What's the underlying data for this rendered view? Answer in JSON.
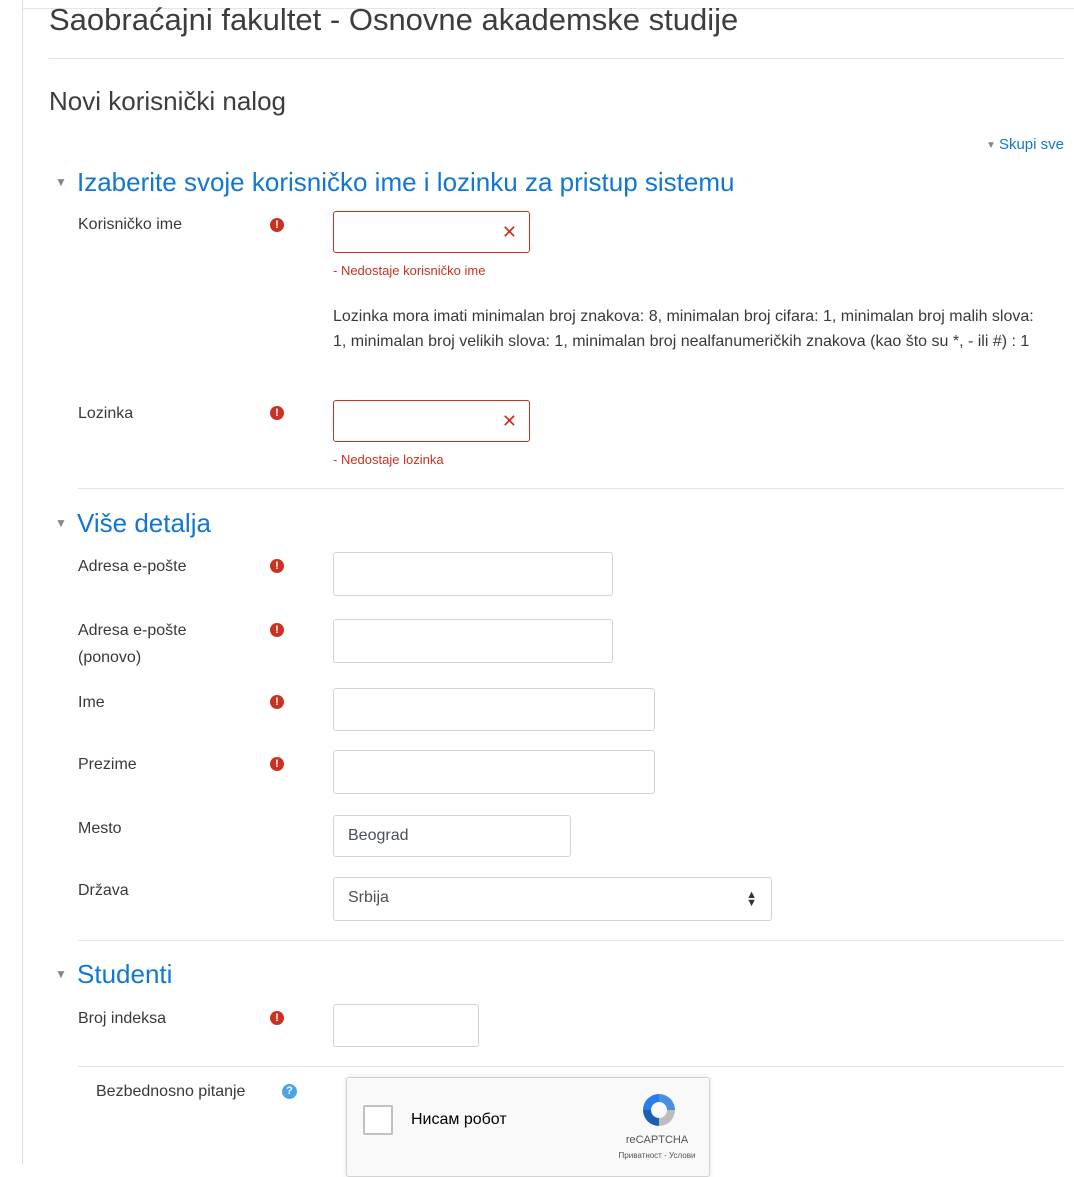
{
  "site_title": "Saobraćajni fakultet - Osnovne akademske studije",
  "page_title": "Novi korisnički nalog",
  "collapse_all_label": "Skupi sve",
  "sections": {
    "credentials": {
      "title": "Izaberite svoje korisničko ime i lozinku za pristup sistemu",
      "username_label": "Korisničko ime",
      "username_value": "",
      "username_error": "- Nedostaje korisničko ime",
      "password_policy": "Lozinka mora imati minimalan broj znakova: 8, minimalan broj cifara: 1, minimalan broj malih slova: 1, minimalan broj velikih slova: 1, minimalan broj nealfanumeričkih znakova (kao što su *, - ili #) : 1",
      "password_label": "Lozinka",
      "password_value": "",
      "password_error": "- Nedostaje lozinka"
    },
    "details": {
      "title": "Više detalja",
      "email_label": "Adresa e-pošte",
      "email_value": "",
      "email_again_label_1": "Adresa e-pošte",
      "email_again_label_2": "(ponovo)",
      "email_again_value": "",
      "firstname_label": "Ime",
      "firstname_value": "",
      "lastname_label": "Prezime",
      "lastname_value": "",
      "city_label": "Mesto",
      "city_value": "Beograd",
      "country_label": "Država",
      "country_value": "Srbija"
    },
    "students": {
      "title": "Studenti",
      "index_label": "Broj indeksa",
      "index_value": ""
    }
  },
  "security_question_label": "Bezbednosno pitanje",
  "captcha": {
    "checkbox_label": "Нисам робот",
    "brand": "reCAPTCHA",
    "links": "Приватност - Услови"
  },
  "icons": {
    "required": "exclamation-circle-icon",
    "help": "question-circle-icon",
    "clear": "times-icon",
    "collapse": "caret-down-icon",
    "select": "sort-arrows-icon"
  },
  "colors": {
    "link_blue": "#1177d1",
    "error_red": "#ca3120",
    "help_blue": "#4aa5e6"
  }
}
